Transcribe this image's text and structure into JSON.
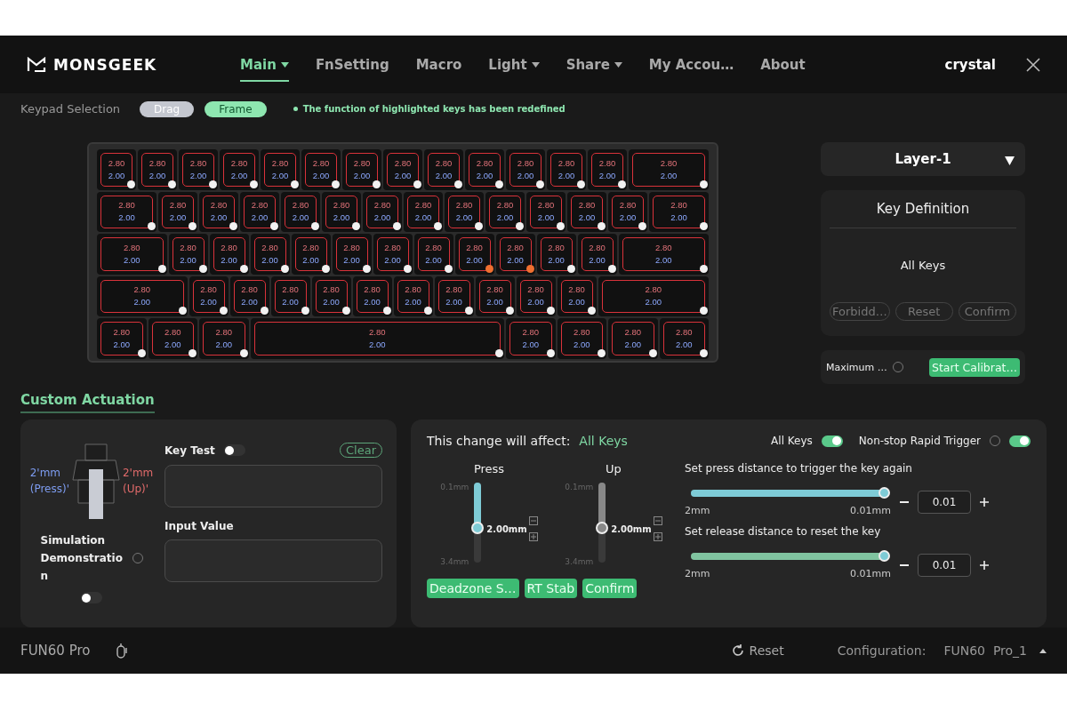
{
  "header": {
    "logo": "MONSGEEK",
    "nav": [
      {
        "label": "Main",
        "selected": true,
        "dropdown": true
      },
      {
        "label": "FnSetting",
        "selected": false,
        "dropdown": false
      },
      {
        "label": "Macro",
        "selected": false,
        "dropdown": false
      },
      {
        "label": "Light",
        "selected": false,
        "dropdown": true
      },
      {
        "label": "Share",
        "selected": false,
        "dropdown": true
      },
      {
        "label": "My Accou…",
        "selected": false,
        "dropdown": false
      },
      {
        "label": "About",
        "selected": false,
        "dropdown": false
      }
    ],
    "user": "crystal"
  },
  "keypad_selection": {
    "label": "Keypad Selection",
    "modes": [
      {
        "label": "Drag",
        "selected": false
      },
      {
        "label": "Frame",
        "selected": true
      }
    ],
    "notice": "The function of highlighted keys has been redefined"
  },
  "keyboard": {
    "rows": [
      [
        {
          "press": "2.80",
          "release": "2.00",
          "highlighted": false
        },
        {
          "press": "2.80",
          "release": "2.00",
          "highlighted": false
        },
        {
          "press": "2.80",
          "release": "2.00",
          "highlighted": false
        },
        {
          "press": "2.80",
          "release": "2.00",
          "highlighted": false
        },
        {
          "press": "2.80",
          "release": "2.00",
          "highlighted": false
        },
        {
          "press": "2.80",
          "release": "2.00",
          "highlighted": false
        },
        {
          "press": "2.80",
          "release": "2.00",
          "highlighted": false
        },
        {
          "press": "2.80",
          "release": "2.00",
          "highlighted": false
        },
        {
          "press": "2.80",
          "release": "2.00",
          "highlighted": false
        },
        {
          "press": "2.80",
          "release": "2.00",
          "highlighted": false
        },
        {
          "press": "2.80",
          "release": "2.00",
          "highlighted": false
        },
        {
          "press": "2.80",
          "release": "2.00",
          "highlighted": false
        },
        {
          "press": "2.80",
          "release": "2.00",
          "highlighted": false
        },
        {
          "press": "2.80",
          "release": "2.00",
          "highlighted": false
        }
      ],
      [
        {
          "press": "2.80",
          "release": "2.00",
          "highlighted": false
        },
        {
          "press": "2.80",
          "release": "2.00",
          "highlighted": false
        },
        {
          "press": "2.80",
          "release": "2.00",
          "highlighted": false
        },
        {
          "press": "2.80",
          "release": "2.00",
          "highlighted": false
        },
        {
          "press": "2.80",
          "release": "2.00",
          "highlighted": false
        },
        {
          "press": "2.80",
          "release": "2.00",
          "highlighted": false
        },
        {
          "press": "2.80",
          "release": "2.00",
          "highlighted": false
        },
        {
          "press": "2.80",
          "release": "2.00",
          "highlighted": false
        },
        {
          "press": "2.80",
          "release": "2.00",
          "highlighted": false
        },
        {
          "press": "2.80",
          "release": "2.00",
          "highlighted": false
        },
        {
          "press": "2.80",
          "release": "2.00",
          "highlighted": false
        },
        {
          "press": "2.80",
          "release": "2.00",
          "highlighted": false
        },
        {
          "press": "2.80",
          "release": "2.00",
          "highlighted": false
        },
        {
          "press": "2.80",
          "release": "2.00",
          "highlighted": false
        }
      ],
      [
        {
          "press": "2.80",
          "release": "2.00",
          "highlighted": false
        },
        {
          "press": "2.80",
          "release": "2.00",
          "highlighted": false
        },
        {
          "press": "2.80",
          "release": "2.00",
          "highlighted": false
        },
        {
          "press": "2.80",
          "release": "2.00",
          "highlighted": false
        },
        {
          "press": "2.80",
          "release": "2.00",
          "highlighted": false
        },
        {
          "press": "2.80",
          "release": "2.00",
          "highlighted": false
        },
        {
          "press": "2.80",
          "release": "2.00",
          "highlighted": false
        },
        {
          "press": "2.80",
          "release": "2.00",
          "highlighted": false
        },
        {
          "press": "2.80",
          "release": "2.00",
          "highlighted": true
        },
        {
          "press": "2.80",
          "release": "2.00",
          "highlighted": true
        },
        {
          "press": "2.80",
          "release": "2.00",
          "highlighted": false
        },
        {
          "press": "2.80",
          "release": "2.00",
          "highlighted": false
        },
        {
          "press": "2.80",
          "release": "2.00",
          "highlighted": false
        }
      ],
      [
        {
          "press": "2.80",
          "release": "2.00",
          "highlighted": false
        },
        {
          "press": "2.80",
          "release": "2.00",
          "highlighted": false
        },
        {
          "press": "2.80",
          "release": "2.00",
          "highlighted": false
        },
        {
          "press": "2.80",
          "release": "2.00",
          "highlighted": false
        },
        {
          "press": "2.80",
          "release": "2.00",
          "highlighted": false
        },
        {
          "press": "2.80",
          "release": "2.00",
          "highlighted": false
        },
        {
          "press": "2.80",
          "release": "2.00",
          "highlighted": false
        },
        {
          "press": "2.80",
          "release": "2.00",
          "highlighted": false
        },
        {
          "press": "2.80",
          "release": "2.00",
          "highlighted": false
        },
        {
          "press": "2.80",
          "release": "2.00",
          "highlighted": false
        },
        {
          "press": "2.80",
          "release": "2.00",
          "highlighted": false
        },
        {
          "press": "2.80",
          "release": "2.00",
          "highlighted": false
        }
      ],
      [
        {
          "press": "2.80",
          "release": "2.00",
          "highlighted": false
        },
        {
          "press": "2.80",
          "release": "2.00",
          "highlighted": false
        },
        {
          "press": "2.80",
          "release": "2.00",
          "highlighted": false
        },
        {
          "press": "2.80",
          "release": "2.00",
          "highlighted": false
        },
        {
          "press": "2.80",
          "release": "2.00",
          "highlighted": false
        },
        {
          "press": "2.80",
          "release": "2.00",
          "highlighted": false
        },
        {
          "press": "2.80",
          "release": "2.00",
          "highlighted": false
        },
        {
          "press": "2.80",
          "release": "2.00",
          "highlighted": false
        }
      ]
    ]
  },
  "layer": {
    "value": "Layer-1"
  },
  "key_definition": {
    "title": "Key Definition",
    "target": "All Keys",
    "buttons": [
      "Forbidd…",
      "Reset",
      "Confirm"
    ]
  },
  "calibration": {
    "label": "Maximum …",
    "button": "Start Calibrat…"
  },
  "custom_actuation": {
    "title": "Custom Actuation",
    "simulation": {
      "press_value": "2'mm",
      "press_label": "(Press)'",
      "up_value": "2'mm",
      "up_label": "(Up)'",
      "label": "Simulation Demonstration",
      "on": false
    },
    "key_test": {
      "label": "Key Test",
      "on": false,
      "clear": "Clear"
    },
    "input_value": {
      "label": "Input Value"
    },
    "affect_label": "This change will affect:",
    "affect_value": "All Keys",
    "toggles": [
      {
        "label": "All Keys",
        "on": true,
        "help": false
      },
      {
        "label": "Non-stop Rapid Trigger",
        "on": true,
        "help": true
      }
    ],
    "vertical_sliders": [
      {
        "label": "Press",
        "min": "0.1mm",
        "max": "3.4mm",
        "value": "2.00mm",
        "level": 0.57,
        "active": true
      },
      {
        "label": "Up",
        "min": "0.1mm",
        "max": "3.4mm",
        "value": "2.00mm",
        "level": 0.57,
        "active": false
      }
    ],
    "buttons": [
      "Deadzone S…",
      "RT Stab",
      "Confirm"
    ],
    "distance_sliders": [
      {
        "label": "Set press distance to trigger the key again",
        "min": "2mm",
        "max": "0.01mm",
        "level": 1,
        "value": "0.01",
        "color": "#7ecbd6"
      },
      {
        "label": "Set release distance to reset the key",
        "min": "2mm",
        "max": "0.01mm",
        "level": 1,
        "value": "0.01",
        "color": "#80c4a0"
      }
    ]
  },
  "footer": {
    "device": "FUN60 Pro",
    "reset": "Reset",
    "config_label": "Configuration:",
    "config_value": "FUN60  Pro_1"
  }
}
